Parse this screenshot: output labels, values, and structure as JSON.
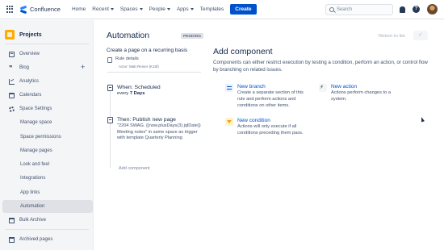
{
  "topbar": {
    "app_name": "Confluence",
    "nav": [
      {
        "label": "Home",
        "dropdown": false
      },
      {
        "label": "Recent",
        "dropdown": true
      },
      {
        "label": "Spaces",
        "dropdown": true
      },
      {
        "label": "People",
        "dropdown": true
      },
      {
        "label": "Apps",
        "dropdown": true
      },
      {
        "label": "Templates",
        "dropdown": false
      }
    ],
    "create_label": "Create",
    "search_placeholder": "Search",
    "accent_color": "#0052cc"
  },
  "sidebar": {
    "space_name": "Projects",
    "items": [
      {
        "label": "Overview",
        "icon": "overview-icon"
      },
      {
        "label": "Blog",
        "icon": "blog-icon"
      },
      {
        "label": "Analytics",
        "icon": "analytics-icon"
      },
      {
        "label": "Calendars",
        "icon": "calendar-icon"
      },
      {
        "label": "Space Settings",
        "icon": "gear-icon"
      },
      {
        "label": "Manage space"
      },
      {
        "label": "Space permissions"
      },
      {
        "label": "Manage pages"
      },
      {
        "label": "Look and feel"
      },
      {
        "label": "Integrations"
      },
      {
        "label": "App links"
      },
      {
        "label": "Automation",
        "active": true
      },
      {
        "label": "Bulk Archive",
        "icon": "archive-icon"
      },
      {
        "label": "Archived pages",
        "icon": "archive-icon"
      }
    ],
    "blog_add": "+"
  },
  "rule": {
    "title": "Automation",
    "status": "PENDING",
    "name": "Create a page on a recurring basis",
    "details_label": "Rule details",
    "actor": "Actor: Matt Reiner (K15f)",
    "trigger_title": "When: Scheduled",
    "trigger_prefix": "every",
    "trigger_value": "7 Days",
    "action_title": "Then: Publish new page",
    "action_desc": "\"2204 SWAG. {{now.plusDays(3).jqlDate}} Meeting notes\" in same space as trigger with template Quarterly Planning",
    "add_component": "Add component"
  },
  "panel": {
    "return_label": "Return to list",
    "check_glyph": "✓",
    "title": "Add component",
    "description": "Components can either restrict execution by testing a condition, perform an action, or control flow by branching on related issues.",
    "components": [
      {
        "title": "New branch",
        "desc": "Create a separate section of this rule and perform actions and conditions on other items.",
        "icon": "branch-icon"
      },
      {
        "title": "New action",
        "desc": "Actions perform changes to a system.",
        "icon": "lightning-icon"
      },
      {
        "title": "New condition",
        "desc": "Actions will only execute if all conditions preceding them pass.",
        "icon": "filter-icon"
      }
    ]
  }
}
